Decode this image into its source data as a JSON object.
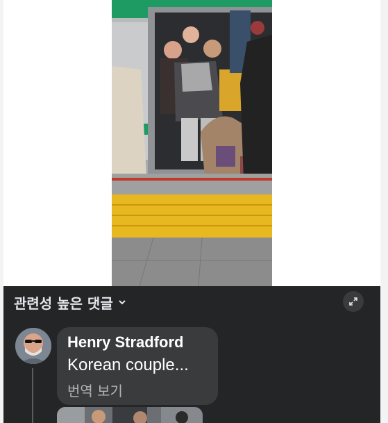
{
  "comments_section": {
    "header_label": "관련성 높은 댓글",
    "comment": {
      "author": "Henry Stradford",
      "text": "Korean couple...",
      "translate_label": "번역 보기"
    }
  },
  "icons": {
    "sort": "chevron-down-icon",
    "expand": "expand-icon"
  },
  "colors": {
    "panel_bg": "#242526",
    "bubble_bg": "#3a3b3c",
    "text_primary": "#e4e6eb",
    "text_secondary": "#b0b3b8",
    "train_stripe": "#1e9a63",
    "tactile_paving": "#e8b820"
  }
}
